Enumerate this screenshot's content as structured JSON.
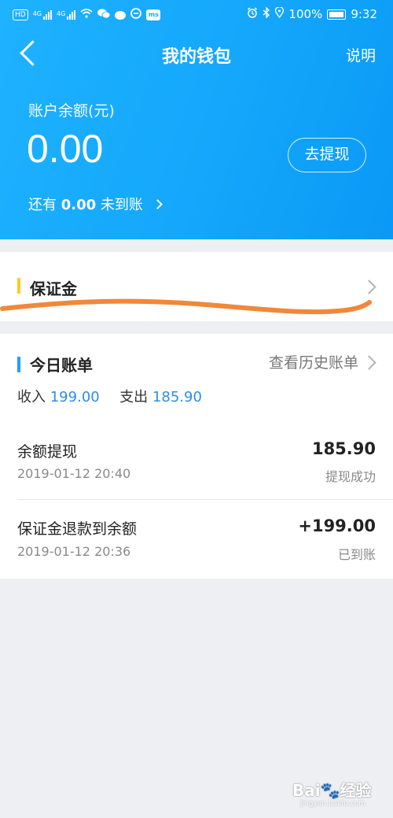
{
  "status_bar": {
    "left_badge": "HD",
    "signal_tag_1": "4G",
    "signal_tag_2": "4G",
    "app_badge": "ms",
    "battery": "100%",
    "time": "9:32"
  },
  "nav": {
    "title": "我的钱包",
    "explain": "说明"
  },
  "account": {
    "label": "账户余额(元)",
    "balance": "0.00",
    "withdraw_button": "去提现",
    "pending_prefix": "还有",
    "pending_amount": "0.00",
    "pending_suffix": "未到账"
  },
  "deposit": {
    "title": "保证金"
  },
  "bills": {
    "title": "今日账单",
    "history_link": "查看历史账单",
    "income_label": "收入",
    "income_value": "199.00",
    "expense_label": "支出",
    "expense_value": "185.90",
    "transactions": [
      {
        "title": "余额提现",
        "time": "2019-01-12 20:40",
        "amount": "185.90",
        "status": "提现成功"
      },
      {
        "title": "保证金退款到余额",
        "time": "2019-01-12 20:36",
        "amount": "+199.00",
        "status": "已到账"
      }
    ]
  },
  "watermark": {
    "text": "Bai🐾经验",
    "url": "jingyan.baidu.com"
  },
  "colors": {
    "header": "#14a7fb",
    "accent_bar_deposit": "#ffc91f",
    "accent_bar_bills": "#1aa0ff",
    "annotation_stroke": "#f0883a"
  }
}
